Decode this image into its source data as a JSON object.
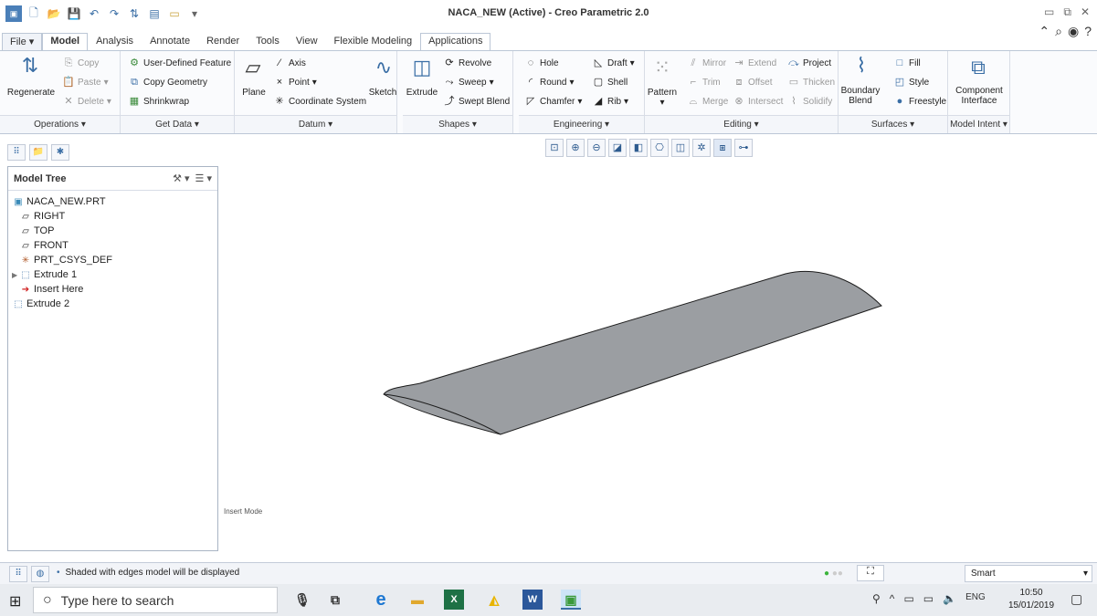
{
  "window": {
    "title": "NACA_NEW (Active) - Creo Parametric 2.0"
  },
  "tabs": [
    "File",
    "Model",
    "Analysis",
    "Annotate",
    "Render",
    "Tools",
    "View",
    "Flexible Modeling",
    "Applications"
  ],
  "ribbon": {
    "operations": {
      "regenerate": "Regenerate",
      "copy": "Copy",
      "paste": "Paste",
      "delete": "Delete",
      "label": "Operations"
    },
    "get_data": {
      "udf": "User-Defined Feature",
      "copy_geometry": "Copy Geometry",
      "shrinkwrap": "Shrinkwrap",
      "label": "Get Data"
    },
    "datum": {
      "plane": "Plane",
      "axis": "Axis",
      "point": "Point",
      "csys": "Coordinate System",
      "sketch": "Sketch",
      "label": "Datum"
    },
    "shapes": {
      "extrude": "Extrude",
      "revolve": "Revolve",
      "sweep": "Sweep",
      "swept_blend": "Swept Blend",
      "label": "Shapes"
    },
    "engineering": {
      "hole": "Hole",
      "round": "Round",
      "chamfer": "Chamfer",
      "draft": "Draft",
      "shell": "Shell",
      "rib": "Rib",
      "label": "Engineering"
    },
    "editing": {
      "pattern": "Pattern",
      "mirror": "Mirror",
      "trim": "Trim",
      "merge": "Merge",
      "extend": "Extend",
      "offset": "Offset",
      "intersect": "Intersect",
      "project": "Project",
      "thicken": "Thicken",
      "solidify": "Solidify",
      "label": "Editing"
    },
    "surfaces": {
      "boundary": "Boundary",
      "blend": "Blend",
      "fill": "Fill",
      "style": "Style",
      "freestyle": "Freestyle",
      "label": "Surfaces"
    },
    "model_intent": {
      "component": "Component",
      "interface": "Interface",
      "label": "Model Intent"
    }
  },
  "model_tree": {
    "header": "Model Tree",
    "items": [
      {
        "label": "NACA_NEW.PRT",
        "icon": "part-icon"
      },
      {
        "label": "RIGHT",
        "icon": "datum-plane-icon"
      },
      {
        "label": "TOP",
        "icon": "datum-plane-icon"
      },
      {
        "label": "FRONT",
        "icon": "datum-plane-icon"
      },
      {
        "label": "PRT_CSYS_DEF",
        "icon": "csys-icon"
      },
      {
        "label": "Extrude 1",
        "icon": "extrude-icon"
      },
      {
        "label": "Insert Here",
        "icon": "insert-arrow-icon"
      },
      {
        "label": "Extrude 2",
        "icon": "extrude-icon"
      }
    ]
  },
  "canvas": {
    "mode_label": "Insert Mode"
  },
  "status": {
    "message": "Shaded with edges model will be displayed",
    "filter": "Smart"
  },
  "taskbar": {
    "search_placeholder": "Type here to search",
    "time": "10:50",
    "date": "15/01/2019",
    "lang": "ENG"
  },
  "colors": {
    "accent": "#3a6ea5",
    "model_fill": "#9b9ea2"
  }
}
